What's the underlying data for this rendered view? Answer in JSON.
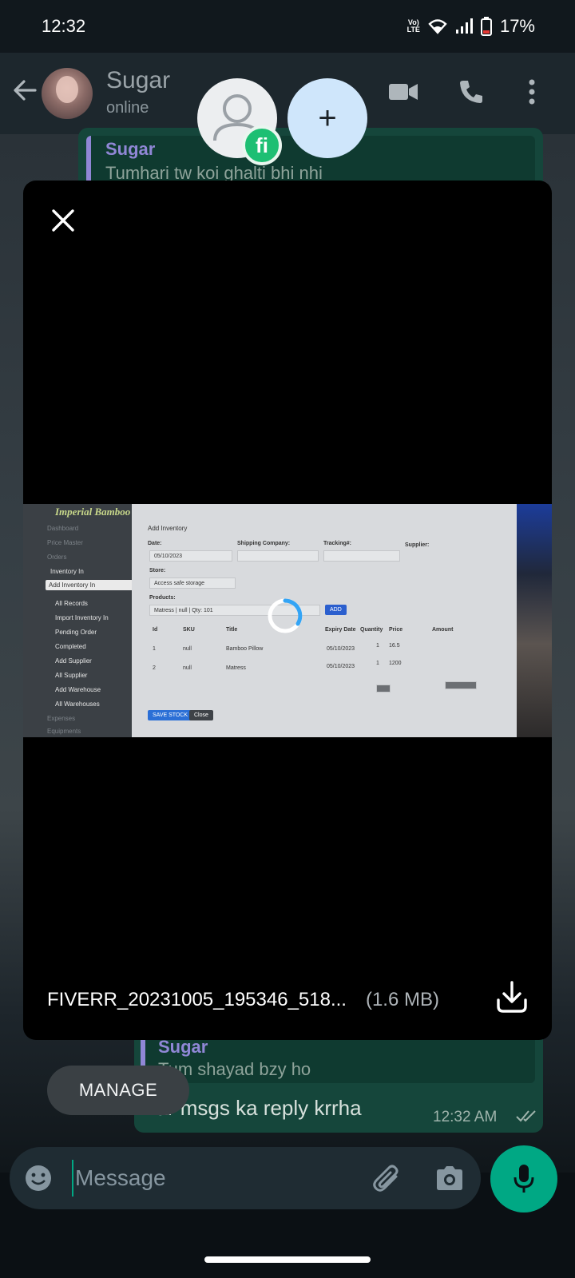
{
  "status_bar": {
    "time": "12:32",
    "volte": "Vo) LTE",
    "battery": "17%"
  },
  "chat": {
    "contact_name": "Sugar",
    "contact_status": "online",
    "top_quote": {
      "name": "Sugar",
      "text": "Tumhari tw koi ghalti bhi nhi"
    },
    "bottom_quote": {
      "name": "Sugar",
      "text": "Tum shayad bzy ho"
    },
    "last_message": "Yar msgs ka reply krrha",
    "last_message_time": "12:32 AM"
  },
  "bubbles": {
    "badge_letters": "fi",
    "add_symbol": "+"
  },
  "media": {
    "file_name": "FIVERR_20231005_195346_518...",
    "file_size": "(1.6 MB)",
    "preview": {
      "logo": "Imperial Bamboo",
      "sidebar_items": [
        "Dashboard",
        "Price Master",
        "Orders",
        "Inventory In",
        "Add Inventory In",
        "All Records",
        "Import Inventory In",
        "Pending Order",
        "Completed",
        "Add Supplier",
        "All Supplier",
        "Add Warehouse",
        "All Warehouses",
        "Expenses",
        "Equipments"
      ],
      "form_title": "Add Inventory",
      "date_label": "Date:",
      "date_value": "05/10/2023",
      "shipping_label": "Shipping Company:",
      "tracking_label": "Tracking#:",
      "supplier_label": "Supplier:",
      "store_label": "Store:",
      "store_value": "Access safe storage",
      "products_label": "Products:",
      "products_value": "Matress | null | Qty: 101",
      "add_label": "ADD",
      "table_headers": [
        "Id",
        "SKU",
        "Title",
        "Expiry Date",
        "Quantity",
        "Price",
        "Amount"
      ],
      "rows": [
        {
          "id": "1",
          "sku": "null",
          "title": "Bamboo Pillow",
          "expiry": "05/10/2023",
          "qty": "1",
          "price": "16.5"
        },
        {
          "id": "2",
          "sku": "null",
          "title": "Matress",
          "expiry": "05/10/2023",
          "qty": "1",
          "price": "1200"
        }
      ],
      "save_label": "SAVE STOCK",
      "close_label": "Close"
    }
  },
  "footer": {
    "manage_label": "MANAGE",
    "message_placeholder": "Message"
  },
  "colors": {
    "accent": "#00a884",
    "bubble": "#15463b",
    "quote_name": "#9087d6"
  }
}
